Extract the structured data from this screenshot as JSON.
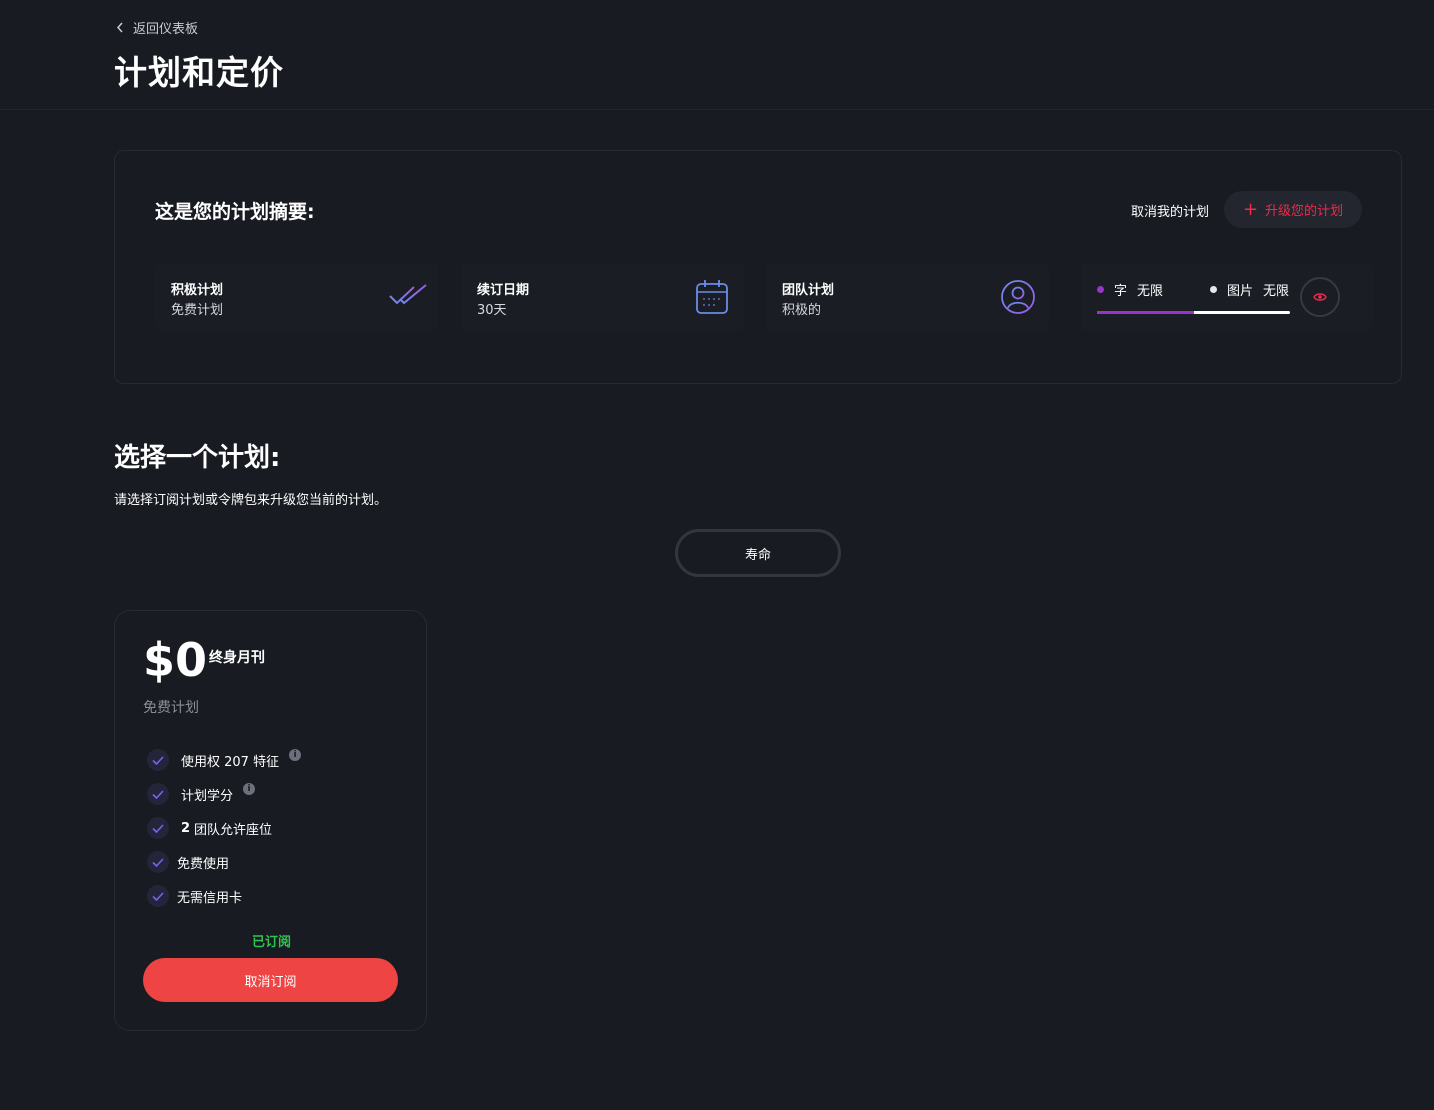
{
  "header": {
    "back_label": "返回仪表板",
    "title": "计划和定价"
  },
  "summary": {
    "title": "这是您的计划摘要:",
    "cancel_plan_label": "取消我的计划",
    "upgrade_label": "升级您的计划",
    "stats": [
      {
        "label": "积极计划",
        "value": "免费计划",
        "icon": "double-check-icon"
      },
      {
        "label": "续订日期",
        "value": "30天",
        "icon": "calendar-icon"
      },
      {
        "label": "团队计划",
        "value": "积极的",
        "icon": "user-circle-icon"
      }
    ],
    "usage": {
      "words_label": "字",
      "words_value": "无限",
      "images_label": "图片",
      "images_value": "无限",
      "words_fraction": 0.5
    }
  },
  "choose": {
    "title": "选择一个计划:",
    "subtitle": "请选择订阅计划或令牌包来升级您当前的计划。",
    "tab_label": "寿命"
  },
  "plan": {
    "price": "$0",
    "period": "终身月刊",
    "name": "免费计划",
    "features": [
      {
        "bold": "",
        "text": "使用权 207 特征",
        "info": true
      },
      {
        "bold": "",
        "text": "计划学分",
        "info": true
      },
      {
        "bold": "2",
        "text": "团队允许座位",
        "info": false
      },
      {
        "bold": "",
        "text": "免费使用",
        "info": false
      },
      {
        "bold": "",
        "text": "无需信用卡",
        "info": false
      }
    ],
    "subscribed_label": "已订阅",
    "cancel_label": "取消订阅"
  },
  "colors": {
    "background": "#181b22",
    "accent_red": "#ef4444",
    "upgrade_red": "#ee2b4a",
    "subscribed_green": "#2fc34f",
    "words_purple": "#9b33c8",
    "icon_blue": "#6b8ce8"
  }
}
